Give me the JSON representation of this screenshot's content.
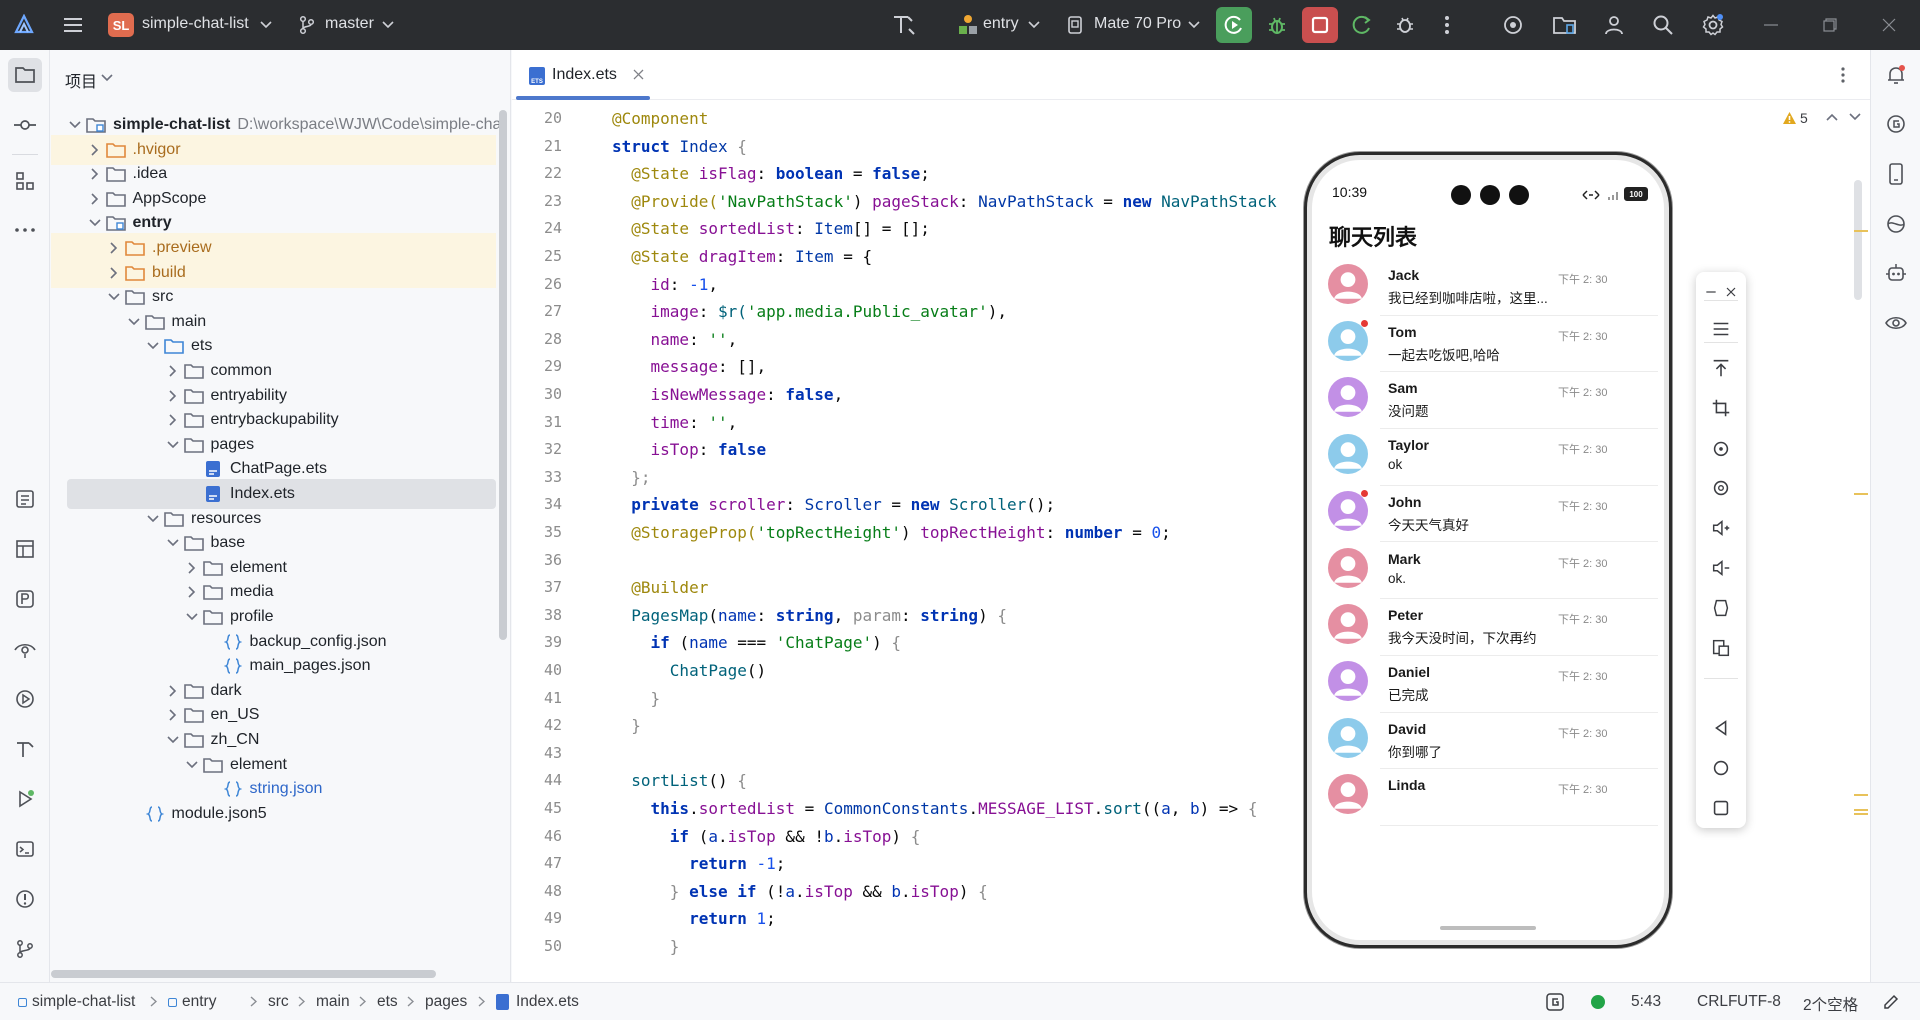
{
  "topbar": {
    "project_badge": "SL",
    "project_name": "simple-chat-list",
    "branch": "master",
    "module": "entry",
    "device": "Mate 70 Pro",
    "colors": {
      "run": "#4a9e5c",
      "stop": "#c94f4f",
      "bg": "#2b2d30"
    }
  },
  "project_panel": {
    "title": "项目",
    "tree": [
      {
        "depth": 0,
        "label": "simple-chat-list",
        "path": "D:\\workspace\\WJW\\Code\\simple-cha",
        "kind": "module",
        "arrow": "down",
        "bold": true
      },
      {
        "depth": 1,
        "label": ".hvigor",
        "kind": "folder-orange",
        "arrow": "right",
        "ignored": true
      },
      {
        "depth": 1,
        "label": ".idea",
        "kind": "folder",
        "arrow": "right"
      },
      {
        "depth": 1,
        "label": "AppScope",
        "kind": "folder",
        "arrow": "right"
      },
      {
        "depth": 1,
        "label": "entry",
        "kind": "module",
        "arrow": "down",
        "bold": true
      },
      {
        "depth": 2,
        "label": ".preview",
        "kind": "folder-orange",
        "arrow": "right",
        "ignored": true
      },
      {
        "depth": 2,
        "label": "build",
        "kind": "folder-orange",
        "arrow": "right",
        "ignored": true
      },
      {
        "depth": 2,
        "label": "src",
        "kind": "folder",
        "arrow": "down"
      },
      {
        "depth": 3,
        "label": "main",
        "kind": "folder",
        "arrow": "down"
      },
      {
        "depth": 4,
        "label": "ets",
        "kind": "folder-blue",
        "arrow": "down"
      },
      {
        "depth": 5,
        "label": "common",
        "kind": "folder",
        "arrow": "right"
      },
      {
        "depth": 5,
        "label": "entryability",
        "kind": "folder",
        "arrow": "right"
      },
      {
        "depth": 5,
        "label": "entrybackupability",
        "kind": "folder",
        "arrow": "right"
      },
      {
        "depth": 5,
        "label": "pages",
        "kind": "folder",
        "arrow": "down"
      },
      {
        "depth": 6,
        "label": "ChatPage.ets",
        "kind": "ets",
        "arrow": "none"
      },
      {
        "depth": 6,
        "label": "Index.ets",
        "kind": "ets",
        "arrow": "none",
        "selected": true
      },
      {
        "depth": 4,
        "label": "resources",
        "kind": "folder",
        "arrow": "down"
      },
      {
        "depth": 5,
        "label": "base",
        "kind": "folder",
        "arrow": "down"
      },
      {
        "depth": 6,
        "label": "element",
        "kind": "folder",
        "arrow": "right"
      },
      {
        "depth": 6,
        "label": "media",
        "kind": "folder",
        "arrow": "right"
      },
      {
        "depth": 6,
        "label": "profile",
        "kind": "folder",
        "arrow": "down"
      },
      {
        "depth": 7,
        "label": "backup_config.json",
        "kind": "json",
        "arrow": "none"
      },
      {
        "depth": 7,
        "label": "main_pages.json",
        "kind": "json",
        "arrow": "none"
      },
      {
        "depth": 5,
        "label": "dark",
        "kind": "folder",
        "arrow": "right"
      },
      {
        "depth": 5,
        "label": "en_US",
        "kind": "folder",
        "arrow": "right"
      },
      {
        "depth": 5,
        "label": "zh_CN",
        "kind": "folder",
        "arrow": "down"
      },
      {
        "depth": 6,
        "label": "element",
        "kind": "folder",
        "arrow": "down"
      },
      {
        "depth": 7,
        "label": "string.json",
        "kind": "json",
        "arrow": "none",
        "blue": true
      },
      {
        "depth": 3,
        "label": "module.json5",
        "kind": "json",
        "arrow": "none"
      }
    ]
  },
  "editor": {
    "tab_label": "Index.ets",
    "tab_badge": "ETS",
    "warning_count": "5",
    "lines": [
      {
        "n": "20",
        "segs": [
          [
            "@Component",
            "an"
          ]
        ]
      },
      {
        "n": "21",
        "segs": [
          [
            "struct ",
            "kw"
          ],
          [
            "Index ",
            "ty"
          ],
          [
            "{",
            "cm"
          ]
        ]
      },
      {
        "n": "22",
        "segs": [
          [
            "  @State ",
            "an"
          ],
          [
            "isFlag",
            "pr"
          ],
          [
            ": ",
            ""
          ],
          [
            "boolean",
            "kw"
          ],
          [
            " = ",
            ""
          ],
          [
            "false",
            "kw"
          ],
          [
            ";",
            ""
          ]
        ]
      },
      {
        "n": "23",
        "segs": [
          [
            "  @Provide(",
            "an"
          ],
          [
            "'NavPathStack'",
            "st"
          ],
          [
            ") ",
            ""
          ],
          [
            "pageStack",
            "pr"
          ],
          [
            ": ",
            ""
          ],
          [
            "NavPathStack",
            "ty"
          ],
          [
            " = ",
            ""
          ],
          [
            "new ",
            "kw"
          ],
          [
            "NavPathStack",
            "fn"
          ]
        ]
      },
      {
        "n": "24",
        "segs": [
          [
            "  @State ",
            "an"
          ],
          [
            "sortedList",
            "pr"
          ],
          [
            ": ",
            ""
          ],
          [
            "Item",
            "ty"
          ],
          [
            "[] = [];",
            ""
          ]
        ]
      },
      {
        "n": "25",
        "segs": [
          [
            "  @State ",
            "an"
          ],
          [
            "dragItem",
            "pr"
          ],
          [
            ": ",
            ""
          ],
          [
            "Item",
            "ty"
          ],
          [
            " = {",
            ""
          ]
        ]
      },
      {
        "n": "26",
        "segs": [
          [
            "    id",
            "pr"
          ],
          [
            ": ",
            ""
          ],
          [
            "-1",
            "nu"
          ],
          [
            ",",
            ""
          ]
        ]
      },
      {
        "n": "27",
        "segs": [
          [
            "    image",
            "pr"
          ],
          [
            ": ",
            ""
          ],
          [
            "$r(",
            "fn"
          ],
          [
            "'app.media.Public_avatar'",
            "st"
          ],
          [
            "),",
            ""
          ]
        ]
      },
      {
        "n": "28",
        "segs": [
          [
            "    name",
            "pr"
          ],
          [
            ": ",
            ""
          ],
          [
            "''",
            "st"
          ],
          [
            ",",
            ""
          ]
        ]
      },
      {
        "n": "29",
        "segs": [
          [
            "    message",
            "pr"
          ],
          [
            ": [],",
            ""
          ]
        ]
      },
      {
        "n": "30",
        "segs": [
          [
            "    isNewMessage",
            "pr"
          ],
          [
            ": ",
            ""
          ],
          [
            "false",
            "kw"
          ],
          [
            ",",
            ""
          ]
        ]
      },
      {
        "n": "31",
        "segs": [
          [
            "    time",
            "pr"
          ],
          [
            ": ",
            ""
          ],
          [
            "''",
            "st"
          ],
          [
            ",",
            ""
          ]
        ]
      },
      {
        "n": "32",
        "segs": [
          [
            "    isTop",
            "pr"
          ],
          [
            ": ",
            ""
          ],
          [
            "false",
            "kw"
          ]
        ]
      },
      {
        "n": "33",
        "segs": [
          [
            "  };",
            "cm"
          ]
        ]
      },
      {
        "n": "34",
        "segs": [
          [
            "  private ",
            "kw"
          ],
          [
            "scroller",
            "pr"
          ],
          [
            ": ",
            ""
          ],
          [
            "Scroller",
            "ty"
          ],
          [
            " = ",
            ""
          ],
          [
            "new ",
            "kw"
          ],
          [
            "Scroller",
            "fn"
          ],
          [
            "();",
            ""
          ]
        ]
      },
      {
        "n": "35",
        "segs": [
          [
            "  @StorageProp(",
            "an"
          ],
          [
            "'topRectHeight'",
            "st"
          ],
          [
            ") ",
            ""
          ],
          [
            "topRectHeight",
            "pr"
          ],
          [
            ": ",
            ""
          ],
          [
            "number",
            "kw"
          ],
          [
            " = ",
            ""
          ],
          [
            "0",
            "nu"
          ],
          [
            ";",
            ""
          ]
        ]
      },
      {
        "n": "36",
        "segs": []
      },
      {
        "n": "37",
        "segs": [
          [
            "  @Builder",
            "an"
          ]
        ]
      },
      {
        "n": "38",
        "segs": [
          [
            "  PagesMap",
            "fn"
          ],
          [
            "(",
            ""
          ],
          [
            "name",
            "k2"
          ],
          [
            ": ",
            ""
          ],
          [
            "string",
            "kw"
          ],
          [
            ", ",
            ""
          ],
          [
            "param",
            "cm"
          ],
          [
            ": ",
            ""
          ],
          [
            "string",
            "kw"
          ],
          [
            ") ",
            ""
          ],
          [
            "{",
            "cm"
          ]
        ]
      },
      {
        "n": "39",
        "segs": [
          [
            "    if ",
            "kw"
          ],
          [
            "(",
            ""
          ],
          [
            "name",
            "k2"
          ],
          [
            " === ",
            ""
          ],
          [
            "'ChatPage'",
            "st"
          ],
          [
            ") ",
            ""
          ],
          [
            "{",
            "cm"
          ]
        ]
      },
      {
        "n": "40",
        "segs": [
          [
            "      ChatPage",
            "fn"
          ],
          [
            "()",
            ""
          ]
        ]
      },
      {
        "n": "41",
        "segs": [
          [
            "    }",
            "cm"
          ]
        ]
      },
      {
        "n": "42",
        "segs": [
          [
            "  }",
            "cm"
          ]
        ]
      },
      {
        "n": "43",
        "segs": []
      },
      {
        "n": "44",
        "segs": [
          [
            "  sortList",
            "fn"
          ],
          [
            "() ",
            ""
          ],
          [
            "{",
            "cm"
          ]
        ]
      },
      {
        "n": "45",
        "segs": [
          [
            "    this",
            "kw"
          ],
          [
            ".",
            ""
          ],
          [
            "sortedList",
            "pr"
          ],
          [
            " = ",
            ""
          ],
          [
            "CommonConstants",
            "ty"
          ],
          [
            ".",
            ""
          ],
          [
            "MESSAGE_LIST",
            "pr"
          ],
          [
            ".",
            ""
          ],
          [
            "sort",
            "fn"
          ],
          [
            "((",
            ""
          ],
          [
            "a",
            "k2"
          ],
          [
            ", ",
            ""
          ],
          [
            "b",
            "k2"
          ],
          [
            ") => ",
            ""
          ],
          [
            "{",
            "cm"
          ]
        ]
      },
      {
        "n": "46",
        "segs": [
          [
            "      if ",
            "kw"
          ],
          [
            "(",
            ""
          ],
          [
            "a",
            "k2"
          ],
          [
            ".",
            ""
          ],
          [
            "isTop",
            "pr"
          ],
          [
            " && !",
            ""
          ],
          [
            "b",
            "k2"
          ],
          [
            ".",
            ""
          ],
          [
            "isTop",
            "pr"
          ],
          [
            ") ",
            ""
          ],
          [
            "{",
            "cm"
          ]
        ]
      },
      {
        "n": "47",
        "segs": [
          [
            "        return ",
            "kw"
          ],
          [
            "-1",
            "nu"
          ],
          [
            ";",
            ""
          ]
        ]
      },
      {
        "n": "48",
        "segs": [
          [
            "      } ",
            "cm"
          ],
          [
            "else if ",
            "kw"
          ],
          [
            "(!",
            ""
          ],
          [
            "a",
            "k2"
          ],
          [
            ".",
            ""
          ],
          [
            "isTop",
            "pr"
          ],
          [
            " && ",
            ""
          ],
          [
            "b",
            "k2"
          ],
          [
            ".",
            ""
          ],
          [
            "isTop",
            "pr"
          ],
          [
            ") ",
            ""
          ],
          [
            "{",
            "cm"
          ]
        ]
      },
      {
        "n": "49",
        "segs": [
          [
            "        return ",
            "kw"
          ],
          [
            "1",
            "nu"
          ],
          [
            ";",
            ""
          ]
        ]
      },
      {
        "n": "50",
        "segs": [
          [
            "      }",
            "cm"
          ]
        ]
      }
    ]
  },
  "phone": {
    "time": "10:39",
    "battery": "100",
    "page_title": "聊天列表",
    "chats": [
      {
        "name": "Jack",
        "message": "我已经到咖啡店啦，这里...",
        "time": "下午 2: 30",
        "avatar": "#e58fa2",
        "unread": false
      },
      {
        "name": "Tom",
        "message": "一起去吃饭吧,哈哈",
        "time": "下午 2: 30",
        "avatar": "#8dcbeb",
        "unread": true
      },
      {
        "name": "Sam",
        "message": "没问题",
        "time": "下午 2: 30",
        "avatar": "#c290e6",
        "unread": false
      },
      {
        "name": "Taylor",
        "message": "ok",
        "time": "下午 2: 30",
        "avatar": "#8dcbeb",
        "unread": false
      },
      {
        "name": "John",
        "message": "今天天气真好",
        "time": "下午 2: 30",
        "avatar": "#c290e6",
        "unread": true
      },
      {
        "name": "Mark",
        "message": "ok.",
        "time": "下午 2: 30",
        "avatar": "#e58fa2",
        "unread": false
      },
      {
        "name": "Peter",
        "message": "我今天没时间，下次再约",
        "time": "下午 2: 30",
        "avatar": "#e58fa2",
        "unread": false
      },
      {
        "name": "Daniel",
        "message": "已完成",
        "time": "下午 2: 30",
        "avatar": "#c290e6",
        "unread": false
      },
      {
        "name": "David",
        "message": "你到哪了",
        "time": "下午 2: 30",
        "avatar": "#8dcbeb",
        "unread": false
      },
      {
        "name": "Linda",
        "message": "",
        "time": "下午 2: 30",
        "avatar": "#e58fa2",
        "unread": false
      }
    ]
  },
  "emulator_toolbar": {
    "icons": [
      "minimize-icon",
      "close-icon",
      "menu-icon",
      "pin-top-icon",
      "crop-icon",
      "rotate-left-icon",
      "rotate-right-icon",
      "volume-up-icon",
      "volume-down-icon",
      "fold-icon",
      "multi-screen-icon",
      "back-icon",
      "home-icon",
      "recents-icon"
    ]
  },
  "breadcrumbs": [
    "simple-chat-list",
    "entry",
    "src",
    "main",
    "ets",
    "pages",
    "Index.ets"
  ],
  "statusbar": {
    "position": "5:43",
    "line_ending": "CRLF",
    "encoding": "UTF-8",
    "indent": "2个空格"
  }
}
